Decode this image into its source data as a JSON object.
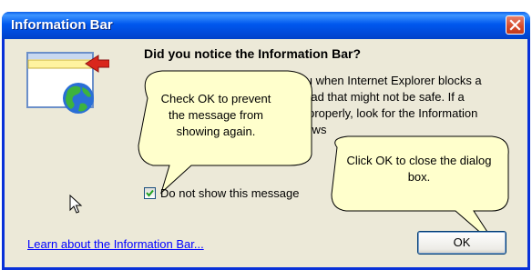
{
  "dialog": {
    "title": "Information Bar",
    "close_icon": "close-icon",
    "heading": "Did you notice the Information Bar?",
    "body_fragments": [
      "you when Internet Explorer blocks a",
      "nload that might not be safe. If a",
      "y properly, look for the Information",
      "rows"
    ],
    "checkbox": {
      "label": "Do not show this message",
      "checked": true
    },
    "link": "Learn about the Information Bar...",
    "ok_label": "OK",
    "icon": "information-bar-icon"
  },
  "callouts": [
    {
      "text": "Check OK to prevent the message from showing again."
    },
    {
      "text": "Click OK to close the dialog box."
    }
  ],
  "colors": {
    "titlebar": "#0058ee",
    "dialog_bg": "#ece9d8",
    "callout_bg": "#ffffcc",
    "arrow": "#d9261c",
    "link": "#0000ff"
  }
}
